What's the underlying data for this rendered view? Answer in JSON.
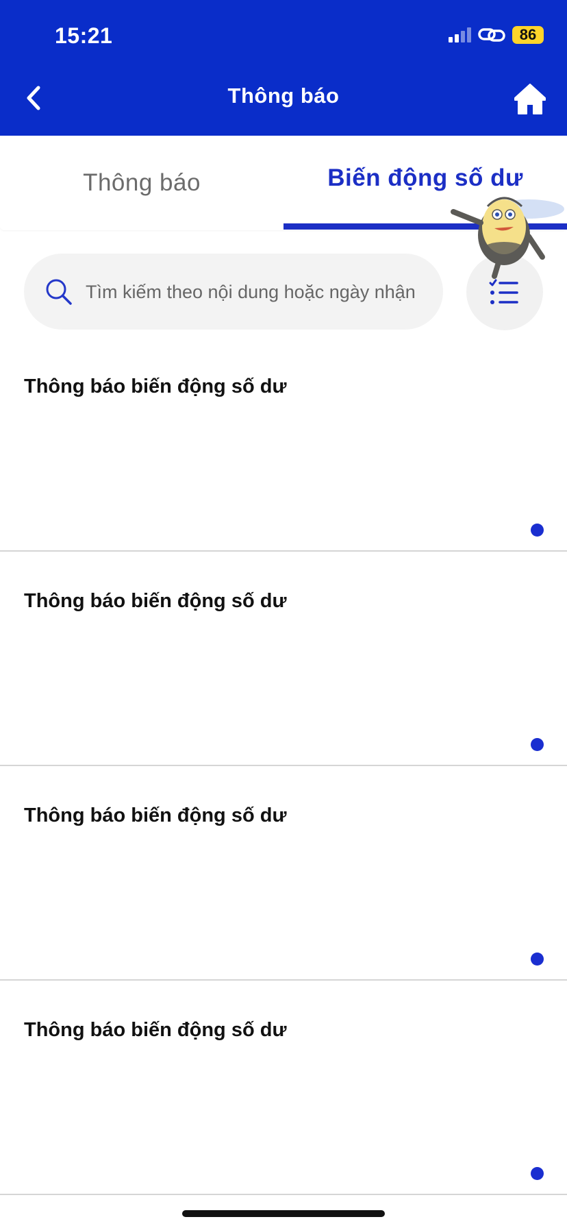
{
  "status_bar": {
    "time": "15:21",
    "battery": "86"
  },
  "header": {
    "title": "Thông báo"
  },
  "tabs": [
    {
      "label": "Thông báo",
      "active": false
    },
    {
      "label": "Biến động số dư",
      "active": true
    }
  ],
  "search": {
    "placeholder": "Tìm kiếm theo nội dung hoặc ngày nhận",
    "value": ""
  },
  "icons": {
    "back": "chevron-left-icon",
    "home": "home-icon",
    "search": "search-icon",
    "filter": "checklist-icon"
  },
  "colors": {
    "brand": "#0a2dc9",
    "accent": "#1c2fc5",
    "unread": "#1a2ed0"
  },
  "notifications": [
    {
      "title": "Thông báo biến động số dư",
      "unread": true
    },
    {
      "title": "Thông báo biến động số dư",
      "unread": true
    },
    {
      "title": "Thông báo biến động số dư",
      "unread": true
    },
    {
      "title": "Thông báo biến động số dư",
      "unread": true
    }
  ]
}
